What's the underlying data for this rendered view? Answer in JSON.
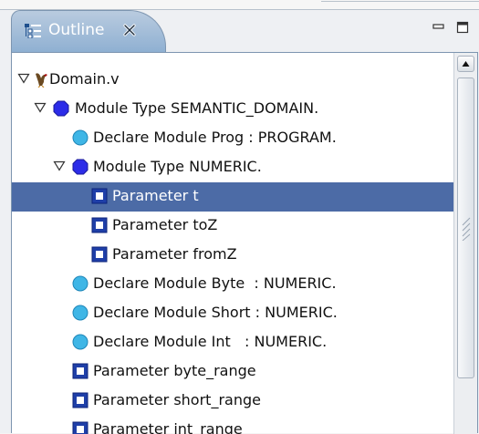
{
  "view": {
    "tab_title": "Outline",
    "tab_icon": "outline-view-icon",
    "close_icon": "close-icon",
    "minimize_icon": "minimize-icon",
    "maximize_icon": "maximize-icon"
  },
  "colors": {
    "tab_gradient_top": "#b9cbdf",
    "tab_gradient_bottom": "#8fb0d2",
    "selection": "#4c6ba6",
    "module_node": "#2c2ce8",
    "declare_node": "#3fb6e6",
    "parameter_node": "#1f3fa8"
  },
  "tree": {
    "rows": [
      {
        "label": "Domain.v",
        "icon": "source-file-icon",
        "expanded": true
      },
      {
        "label": "Module Type SEMANTIC_DOMAIN.",
        "icon": "module-type-icon",
        "expanded": true
      },
      {
        "label": "Declare Module Prog : PROGRAM.",
        "icon": "declare-module-icon"
      },
      {
        "label": "Module Type NUMERIC.",
        "icon": "module-type-icon",
        "expanded": true
      },
      {
        "label": "Parameter t",
        "icon": "parameter-icon",
        "selected": true
      },
      {
        "label": "Parameter toZ",
        "icon": "parameter-icon"
      },
      {
        "label": "Parameter fromZ",
        "icon": "parameter-icon"
      },
      {
        "label": "Declare Module Byte  : NUMERIC.",
        "icon": "declare-module-icon"
      },
      {
        "label": "Declare Module Short : NUMERIC.",
        "icon": "declare-module-icon"
      },
      {
        "label": "Declare Module Int   : NUMERIC.",
        "icon": "declare-module-icon"
      },
      {
        "label": "Parameter byte_range",
        "icon": "parameter-icon"
      },
      {
        "label": "Parameter short_range",
        "icon": "parameter-icon"
      },
      {
        "label": "Parameter int_range",
        "icon": "parameter-icon"
      }
    ]
  },
  "scrollbar": {
    "up_icon": "scroll-up-arrow-icon",
    "grip_icon": "scroll-grip-icon"
  }
}
